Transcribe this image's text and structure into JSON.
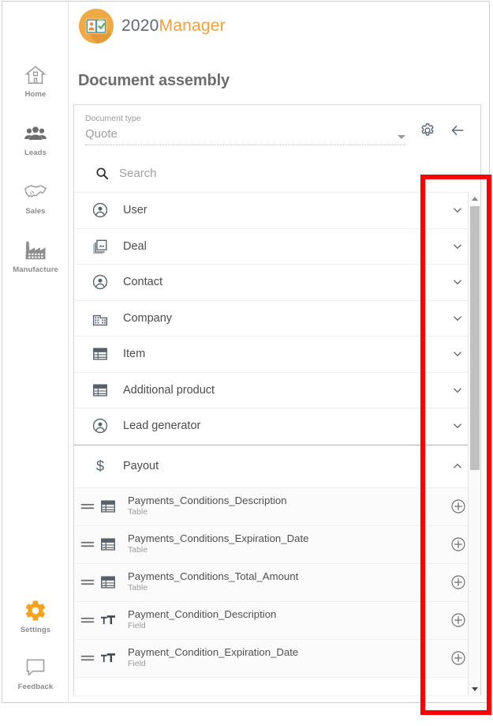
{
  "app": {
    "brand_number": "2020",
    "brand_word": "Manager",
    "brand_icon": "id-card-checklist-icon",
    "page_title": "Document assembly",
    "accent_color": "#f0a23c",
    "annotation_color": "#ff0000"
  },
  "sidebar": {
    "items": [
      {
        "label": "Home",
        "icon": "home-icon",
        "active": false
      },
      {
        "label": "Leads",
        "icon": "people-icon",
        "active": false
      },
      {
        "label": "Sales",
        "icon": "handshake-icon",
        "active": false
      },
      {
        "label": "Manufacture",
        "icon": "factory-icon",
        "active": false
      },
      {
        "label": "Settings",
        "icon": "gear-icon",
        "active": true
      },
      {
        "label": "Feedback",
        "icon": "speech-bubble-icon",
        "active": false
      }
    ]
  },
  "doctype": {
    "label": "Document type",
    "value": "Quote",
    "caret_icon": "chevron-down-icon",
    "gear_icon": "gear-icon",
    "back_icon": "arrow-left-icon"
  },
  "search": {
    "icon": "search-icon",
    "placeholder": "Search"
  },
  "groups": [
    {
      "label": "User",
      "icon": "account-circle-icon",
      "state": "collapsed",
      "chevron": "chevron-down-icon",
      "separated": false
    },
    {
      "label": "Deal",
      "icon": "collections-icon",
      "state": "collapsed",
      "chevron": "chevron-down-icon",
      "separated": false
    },
    {
      "label": "Contact",
      "icon": "account-circle-icon",
      "state": "collapsed",
      "chevron": "chevron-down-icon",
      "separated": false
    },
    {
      "label": "Company",
      "icon": "building-icon",
      "state": "collapsed",
      "chevron": "chevron-down-icon",
      "separated": false
    },
    {
      "label": "Item",
      "icon": "table-icon",
      "state": "collapsed",
      "chevron": "chevron-down-icon",
      "separated": false
    },
    {
      "label": "Additional product",
      "icon": "table-icon",
      "state": "collapsed",
      "chevron": "chevron-down-icon",
      "separated": false
    },
    {
      "label": "Lead generator",
      "icon": "account-circle-icon",
      "state": "collapsed",
      "chevron": "chevron-down-icon",
      "separated": false
    },
    {
      "label": "Payout",
      "icon": "dollar-icon",
      "state": "expanded",
      "chevron": "chevron-up-icon",
      "separated": true
    }
  ],
  "payout_fields": [
    {
      "title": "Payments_Conditions_Description",
      "subtitle": "Table",
      "icon": "table-icon",
      "handle": "drag-handle-icon",
      "add": "add-circle-icon"
    },
    {
      "title": "Payments_Conditions_Expiration_Date",
      "subtitle": "Table",
      "icon": "table-icon",
      "handle": "drag-handle-icon",
      "add": "add-circle-icon"
    },
    {
      "title": "Payments_Conditions_Total_Amount",
      "subtitle": "Table",
      "icon": "table-icon",
      "handle": "drag-handle-icon",
      "add": "add-circle-icon"
    },
    {
      "title": "Payment_Condition_Description",
      "subtitle": "Field",
      "icon": "text-format-icon",
      "handle": "drag-handle-icon",
      "add": "add-circle-icon"
    },
    {
      "title": "Payment_Condition_Expiration_Date",
      "subtitle": "Field",
      "icon": "text-format-icon",
      "handle": "drag-handle-icon",
      "add": "add-circle-icon"
    }
  ],
  "scrollbar": {
    "up_icon": "scroll-up-arrow-icon",
    "down_icon": "scroll-down-arrow-icon",
    "thumb": "scrollbar-thumb"
  }
}
